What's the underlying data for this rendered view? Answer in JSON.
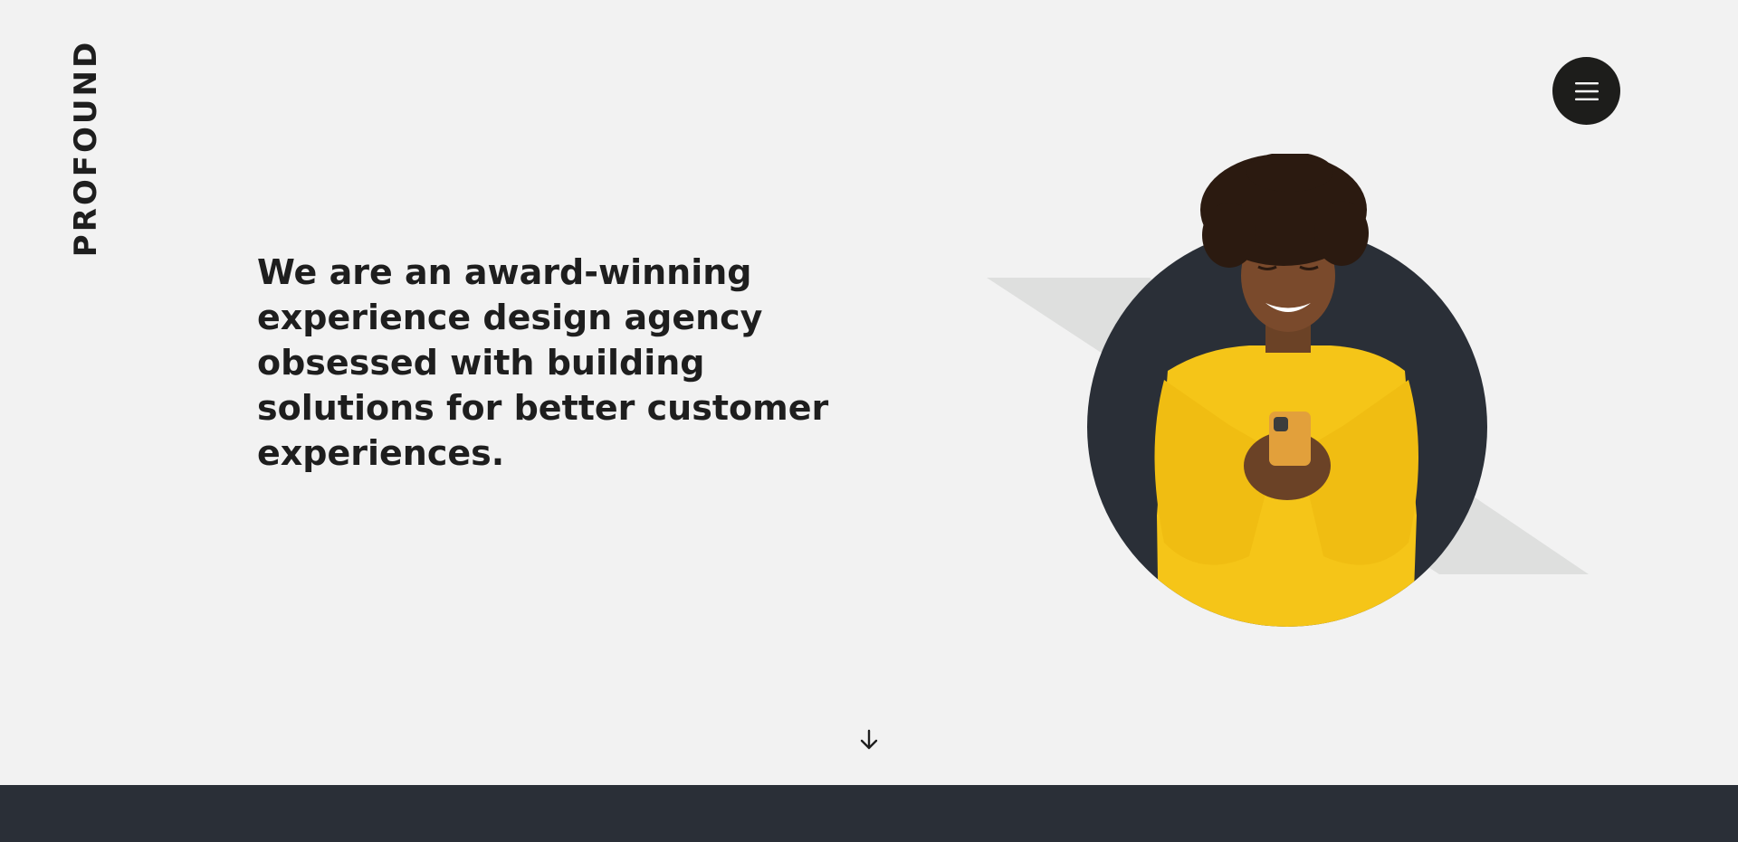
{
  "brand": {
    "logo_text": "PROFOUND"
  },
  "header": {
    "menu_icon": "hamburger-icon"
  },
  "hero": {
    "headline": "We are an award-winning experience design agency obsessed with building solutions for better customer experiences.",
    "image_subject": "person-with-phone"
  },
  "scroll": {
    "icon": "arrow-down-icon"
  },
  "colors": {
    "background": "#f2f2f2",
    "text": "#1e1e1e",
    "menu_button": "#1d1d1b",
    "circle": "#2a2f37",
    "diagonal_band": "#dedfde",
    "sweater": "#f5c518",
    "footer": "#2a2f37"
  }
}
